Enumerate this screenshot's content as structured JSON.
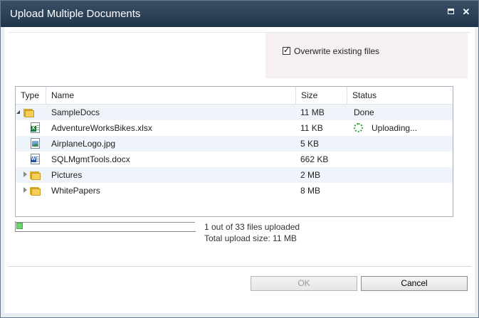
{
  "window": {
    "title": "Upload Multiple Documents"
  },
  "options": {
    "overwrite_label": "Overwrite existing files",
    "overwrite_checked": true
  },
  "table": {
    "headers": {
      "type": "Type",
      "name": "Name",
      "size": "Size",
      "status": "Status"
    },
    "rows": [
      {
        "icon": "folder-icon",
        "name": "SampleDocs",
        "size": "11 MB",
        "status": "Done",
        "expanded": true
      },
      {
        "icon": "excel-file-icon",
        "name": "AdventureWorksBikes.xlsx",
        "size": "11 KB",
        "status": "Uploading..."
      },
      {
        "icon": "image-file-icon",
        "name": "AirplaneLogo.jpg",
        "size": "5 KB",
        "status": ""
      },
      {
        "icon": "word-file-icon",
        "name": "SQLMgmtTools.docx",
        "size": "662 KB",
        "status": ""
      },
      {
        "icon": "folder-icon",
        "name": "Pictures",
        "size": "2 MB",
        "status": "",
        "expanded": false
      },
      {
        "icon": "folder-icon",
        "name": "WhitePapers",
        "size": "8 MB",
        "status": "",
        "expanded": false
      }
    ]
  },
  "progress": {
    "files_uploaded": 1,
    "files_total": 33,
    "summary": "1 out of 33 files uploaded",
    "total_size": "Total upload size: 11 MB"
  },
  "buttons": {
    "ok": "OK",
    "cancel": "Cancel"
  },
  "colors": {
    "titlebar": "#2b4058",
    "progress": "#6fd36f",
    "alt_row": "#eef4fa",
    "options_panel": "#f6f0f5"
  }
}
